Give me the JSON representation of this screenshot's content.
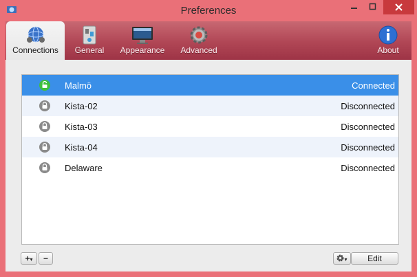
{
  "window": {
    "title": "Preferences"
  },
  "toolbar": {
    "tabs": [
      {
        "label": "Connections",
        "icon": "globe-network-icon",
        "active": true
      },
      {
        "label": "General",
        "icon": "switch-panel-icon",
        "active": false
      },
      {
        "label": "Appearance",
        "icon": "monitor-icon",
        "active": false
      },
      {
        "label": "Advanced",
        "icon": "gear-icon",
        "active": false
      }
    ],
    "about": {
      "label": "About",
      "icon": "info-icon"
    }
  },
  "connections": [
    {
      "name": "Malmö",
      "status": "Connected",
      "selected": true,
      "icon": "lock-open-green-icon"
    },
    {
      "name": "Kista-02",
      "status": "Disconnected",
      "selected": false,
      "icon": "lock-icon"
    },
    {
      "name": "Kista-03",
      "status": "Disconnected",
      "selected": false,
      "icon": "lock-icon"
    },
    {
      "name": "Kista-04",
      "status": "Disconnected",
      "selected": false,
      "icon": "lock-icon"
    },
    {
      "name": "Delaware",
      "status": "Disconnected",
      "selected": false,
      "icon": "lock-icon"
    }
  ],
  "bottom_bar": {
    "add_label": "+",
    "add_caret": "▾",
    "remove_label": "−",
    "gear_caret": "▾",
    "edit_label": "Edit"
  },
  "colors": {
    "frame": "#ea7078",
    "toolbar": "#b04655",
    "selection": "#3a8fe8",
    "connected": "#3fbf3f",
    "lock_gray": "#8a8a8a",
    "close_button": "#c8393d"
  }
}
